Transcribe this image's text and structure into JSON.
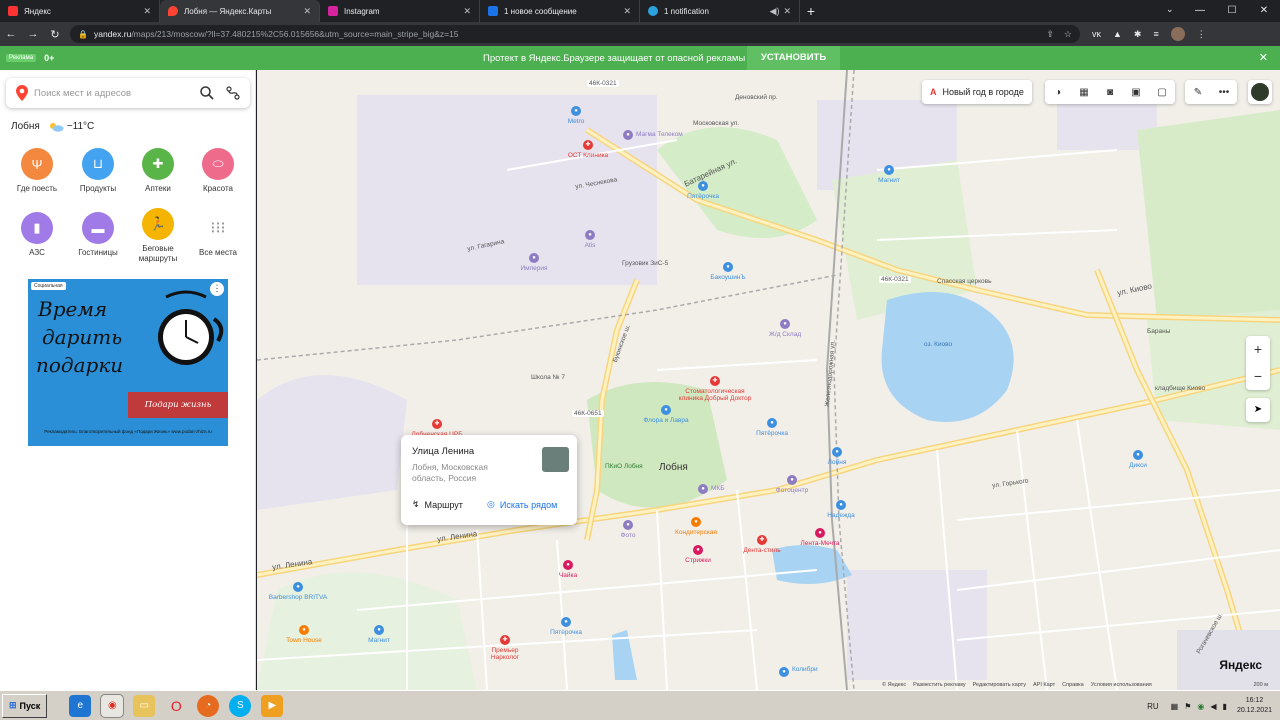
{
  "browser": {
    "tabs": [
      {
        "title": "Яндекс",
        "color": "#ff3333",
        "active": false
      },
      {
        "title": "Лобня — Яндекс.Карты",
        "color": "#ff4433",
        "active": true
      },
      {
        "title": "Instagram",
        "color": "#d6249f",
        "active": false
      },
      {
        "title": "1 новое сообщение",
        "color": "#1a73e8",
        "active": false
      },
      {
        "title": "1 notification",
        "color": "#2aa3df",
        "active": false
      }
    ],
    "url_main": "yandex.ru",
    "url_rest": "/maps/213/moscow/?ll=37.480215%2C56.015656&utm_source=main_stripe_big&z=15"
  },
  "promo": {
    "tag": "Реклама",
    "age": "0+",
    "message": "Протект в Яндекс.Браузере защищает от опасной рекламы",
    "install": "УСТАНОВИТЬ"
  },
  "sidebar": {
    "search_placeholder": "Поиск мест и адресов",
    "city": "Лобня",
    "weather": "−11°C",
    "categories": [
      {
        "label": "Где поесть",
        "color": "#f5883f",
        "icon": "fork-knife-icon",
        "glyph": "🍴"
      },
      {
        "label": "Продукты",
        "color": "#44a3f0",
        "icon": "basket-icon",
        "glyph": "🧺"
      },
      {
        "label": "Аптеки",
        "color": "#5ab549",
        "icon": "pharmacy-cross-icon",
        "glyph": "✚"
      },
      {
        "label": "Красота",
        "color": "#ee6b8c",
        "icon": "lips-icon",
        "glyph": "◉"
      },
      {
        "label": "АЗС",
        "color": "#a07ae6",
        "icon": "fuel-pump-icon",
        "glyph": "⛽"
      },
      {
        "label": "Гостиницы",
        "color": "#a07ae6",
        "icon": "bed-icon",
        "glyph": "🛏"
      },
      {
        "label": "Беговые маршруты",
        "color": "#f4b400",
        "icon": "runner-icon",
        "glyph": "🏃"
      },
      {
        "label": "Все места",
        "color": "#ffffff",
        "icon": "grid-dots-icon",
        "glyph": "⋯"
      }
    ],
    "ad": {
      "badge": "Социальная",
      "line1": "Время",
      "line2": "дарить",
      "line3": "подарки",
      "brand": "Подари жизнь",
      "legal": "Рекламодатель: Благотворительный фонд «Подари Жизнь» www.podari-zhizn.ru"
    }
  },
  "map": {
    "new_year_button": "Новый год в городе",
    "popup": {
      "title": "Улица Ленина",
      "address": "Лобня, Московская область, Россия",
      "route": "Маршрут",
      "nearby": "Искать рядом"
    },
    "labels": {
      "city": "Лобня",
      "lake": "оз. Киово",
      "street_lenina": "ул. Ленина",
      "street_batareynaya": "Батарейная ул.",
      "street_kiovo": "ул. Киово",
      "street_gorkogo": "ул. Горького",
      "street_bukinskoe": "Букинское ш.",
      "street_rogachevskoe": "Рогачевское ш.",
      "street_zheleznodorozhnaya": "Железнодорожная ул.",
      "street_gagarina": "ул. Гагарина",
      "street_chestnikova": "ул. Чеснекова",
      "street_moskovskaya": "Московская ул.",
      "street_denisovsky": "Деновский пр.",
      "road_46k0321a": "46К-0321",
      "road_46k0321b": "46К-0321",
      "road_46k0651": "46К-0651",
      "school": "Школа № 7",
      "gruzovik": "Грузовик ЗиС-5",
      "cemetery": "кладбище Киово",
      "spasskaya": "Спасская церковь",
      "barany": "Бараны",
      "park": "ПКиО Лобня"
    },
    "pois": [
      {
        "name": "Metro",
        "color": "#3d8fe0"
      },
      {
        "name": "ОСТ Клиника",
        "color": "#e53935"
      },
      {
        "name": "Магма Телеком",
        "color": "#8e7cc3"
      },
      {
        "name": "Пятёрочка",
        "color": "#3d8fe0"
      },
      {
        "name": "Магнит",
        "color": "#3d8fe0"
      },
      {
        "name": "Atis",
        "color": "#8e7cc3"
      },
      {
        "name": "Империя",
        "color": "#8e7cc3"
      },
      {
        "name": "БакоушинЪ",
        "color": "#3d8fe0"
      },
      {
        "name": "Ж/д Склад",
        "color": "#8e7cc3"
      },
      {
        "name": "Стоматологическая клиника Добрый Доктор",
        "color": "#e53935"
      },
      {
        "name": "Флора и Лавра",
        "color": "#3d8fe0"
      },
      {
        "name": "Пятёрочка",
        "color": "#3d8fe0"
      },
      {
        "name": "Лобненская ЦРБ",
        "color": "#e53935"
      },
      {
        "name": "Лобня",
        "color": "#3d8fe0"
      },
      {
        "name": "Дикси",
        "color": "#3d8fe0"
      },
      {
        "name": "МКБ",
        "color": "#8e7cc3"
      },
      {
        "name": "Фотоцентр",
        "color": "#8e7cc3"
      },
      {
        "name": "Надежда",
        "color": "#3d8fe0"
      },
      {
        "name": "Фото",
        "color": "#8e7cc3"
      },
      {
        "name": "Кондитерская",
        "color": "#f57c00"
      },
      {
        "name": "Стрижки",
        "color": "#d81b60"
      },
      {
        "name": "Дента-стиль",
        "color": "#e53935"
      },
      {
        "name": "Лента-Мечта",
        "color": "#d81b60"
      },
      {
        "name": "Чайка",
        "color": "#d81b60"
      },
      {
        "name": "Barbershop BRITVA",
        "color": "#3d8fe0"
      },
      {
        "name": "Town House",
        "color": "#f57c00"
      },
      {
        "name": "Магнит",
        "color": "#3d8fe0"
      },
      {
        "name": "Пятёрочка",
        "color": "#3d8fe0"
      },
      {
        "name": "Премьер Нарколог",
        "color": "#e53935"
      },
      {
        "name": "Колибри",
        "color": "#3d8fe0"
      }
    ],
    "footer": [
      "© Яндекс",
      "Разместить рекламу",
      "Редактировать карту",
      "API Карт",
      "Справка",
      "Условия использования"
    ],
    "logo": "Яндекс",
    "scale": "200 м"
  },
  "taskbar": {
    "start": "Пуск",
    "lang": "RU",
    "time": "16:12",
    "date": "20.12.2021"
  }
}
